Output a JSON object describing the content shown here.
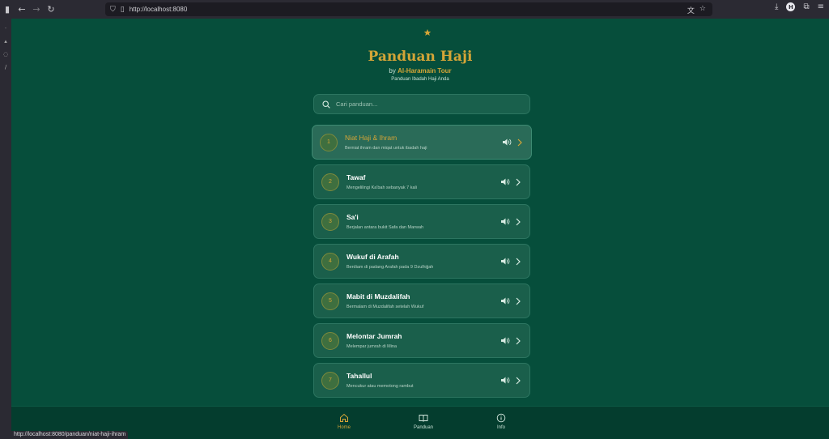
{
  "browser": {
    "url": "http://localhost:8080",
    "status_url": "http://localhost:8080/panduan/niat-haji-ihram"
  },
  "header": {
    "title": "Panduan Haji",
    "by": "by",
    "brand": "Al-Haramain Tour",
    "subtitle": "Panduan Ibadah Haji Anda"
  },
  "search": {
    "placeholder": "Cari panduan..."
  },
  "guides": [
    {
      "number": "1",
      "title": "Niat Haji & Ihram",
      "desc": "Berniat ihram dan miqat untuk ibadah haji"
    },
    {
      "number": "2",
      "title": "Tawaf",
      "desc": "Mengelilingi Ka'bah sebanyak 7 kali"
    },
    {
      "number": "3",
      "title": "Sa'i",
      "desc": "Berjalan antara bukit Safa dan Marwah"
    },
    {
      "number": "4",
      "title": "Wukuf di Arafah",
      "desc": "Berdiam di padang Arafah pada 9 Dzulhijjah"
    },
    {
      "number": "5",
      "title": "Mabit di Muzdalifah",
      "desc": "Bermalam di Muzdalifah setelah Wukuf"
    },
    {
      "number": "6",
      "title": "Melontar Jumrah",
      "desc": "Melempar jumrah di Mina"
    },
    {
      "number": "7",
      "title": "Tahallul",
      "desc": "Mencukur atau memotong rambut"
    }
  ],
  "nav": {
    "home": "Home",
    "panduan": "Panduan",
    "info": "Info"
  },
  "colors": {
    "background": "#064e3b",
    "accent": "#d4a537",
    "card": "#1a5f4b"
  }
}
